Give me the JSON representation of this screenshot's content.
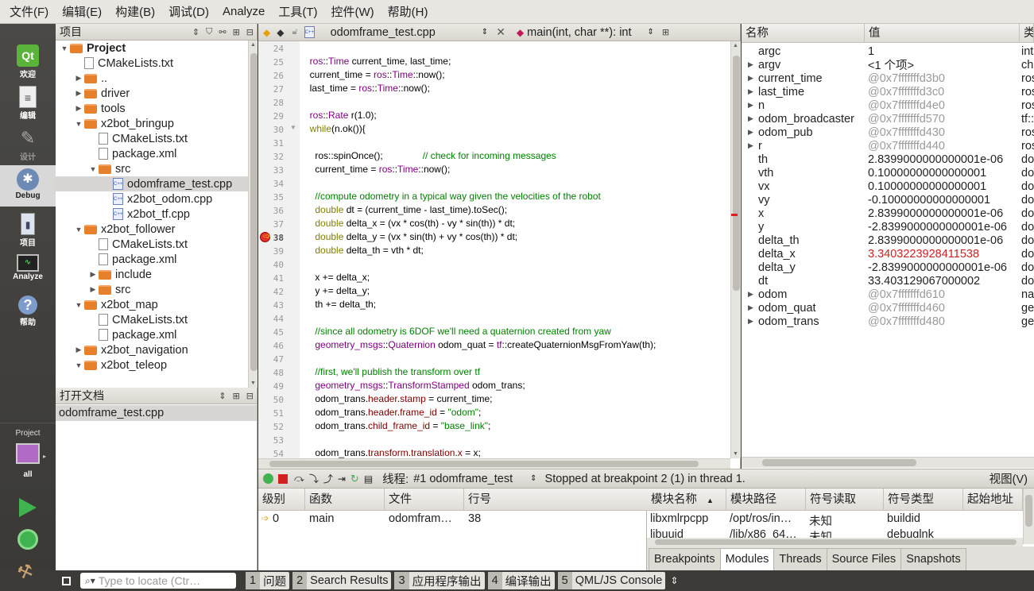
{
  "menu": [
    "文件(F)",
    "编辑(E)",
    "构建(B)",
    "调试(D)",
    "Analyze",
    "工具(T)",
    "控件(W)",
    "帮助(H)"
  ],
  "modes": [
    {
      "label": "欢迎",
      "icon": "qt-logo-icon"
    },
    {
      "label": "编辑",
      "icon": "edit-document-icon"
    },
    {
      "label": "设计",
      "icon": "design-tools-icon"
    },
    {
      "label": "Debug",
      "icon": "debug-bug-icon"
    },
    {
      "label": "项目",
      "icon": "project-wrench-icon"
    },
    {
      "label": "Analyze",
      "icon": "analyze-monitor-icon"
    },
    {
      "label": "帮助",
      "icon": "help-icon"
    }
  ],
  "kit": {
    "project_label": "Project",
    "config_label": "all"
  },
  "project_pane": {
    "title": "项目",
    "tree": [
      {
        "label": "Project",
        "indent": 0,
        "kind": "folder",
        "expanded": true,
        "bold": true
      },
      {
        "label": "CMakeLists.txt",
        "indent": 1,
        "kind": "file"
      },
      {
        "label": "..",
        "indent": 1,
        "kind": "folder",
        "expanded": false
      },
      {
        "label": "driver",
        "indent": 1,
        "kind": "folder",
        "expanded": false
      },
      {
        "label": "tools",
        "indent": 1,
        "kind": "folder",
        "expanded": false
      },
      {
        "label": "x2bot_bringup",
        "indent": 1,
        "kind": "folder",
        "expanded": true
      },
      {
        "label": "CMakeLists.txt",
        "indent": 2,
        "kind": "file"
      },
      {
        "label": "package.xml",
        "indent": 2,
        "kind": "file"
      },
      {
        "label": "src",
        "indent": 2,
        "kind": "folder",
        "expanded": true
      },
      {
        "label": "odomframe_test.cpp",
        "indent": 3,
        "kind": "cpp",
        "selected": true
      },
      {
        "label": "x2bot_odom.cpp",
        "indent": 3,
        "kind": "cpp"
      },
      {
        "label": "x2bot_tf.cpp",
        "indent": 3,
        "kind": "cpp"
      },
      {
        "label": "x2bot_follower",
        "indent": 1,
        "kind": "folder",
        "expanded": true
      },
      {
        "label": "CMakeLists.txt",
        "indent": 2,
        "kind": "file"
      },
      {
        "label": "package.xml",
        "indent": 2,
        "kind": "file"
      },
      {
        "label": "include",
        "indent": 2,
        "kind": "folder",
        "expanded": false
      },
      {
        "label": "src",
        "indent": 2,
        "kind": "folder",
        "expanded": false
      },
      {
        "label": "x2bot_map",
        "indent": 1,
        "kind": "folder",
        "expanded": true
      },
      {
        "label": "CMakeLists.txt",
        "indent": 2,
        "kind": "file"
      },
      {
        "label": "package.xml",
        "indent": 2,
        "kind": "file"
      },
      {
        "label": "x2bot_navigation",
        "indent": 1,
        "kind": "folder",
        "expanded": false
      },
      {
        "label": "x2bot_teleop",
        "indent": 1,
        "kind": "folder",
        "expanded": true
      }
    ]
  },
  "open_docs": {
    "title": "打开文档",
    "items": [
      "odomframe_test.cpp"
    ]
  },
  "editor": {
    "file": "odomframe_test.cpp",
    "function": "main(int, char **): int",
    "breakpoint_line": "38",
    "lines": [
      {
        "n": "24",
        "html": ""
      },
      {
        "n": "25",
        "html": "  <span class=\"ty\">ros</span>::<span class=\"ty\">Time</span> current_time, last_time;"
      },
      {
        "n": "26",
        "html": "  current_time = <span class=\"ty\">ros</span>::<span class=\"ty\">Time</span>::now();"
      },
      {
        "n": "27",
        "html": "  last_time = <span class=\"ty\">ros</span>::<span class=\"ty\">Time</span>::now();"
      },
      {
        "n": "28",
        "html": ""
      },
      {
        "n": "29",
        "html": "  <span class=\"ty\">ros</span>::<span class=\"ty\">Rate</span> r(1.0);"
      },
      {
        "n": "30",
        "html": "  <span class=\"kw\">while</span>(n.ok()){"
      },
      {
        "n": "31",
        "html": ""
      },
      {
        "n": "32",
        "html": "    ros::spinOnce();               <span class=\"cm\">// check for incoming messages</span>"
      },
      {
        "n": "33",
        "html": "    current_time = <span class=\"ty\">ros</span>::<span class=\"ty\">Time</span>::now();"
      },
      {
        "n": "34",
        "html": ""
      },
      {
        "n": "35",
        "html": "    <span class=\"cm\">//compute odometry in a typical way given the velocities of the robot</span>"
      },
      {
        "n": "36",
        "html": "    <span class=\"kw\">double</span> dt = (current_time - last_time).toSec();"
      },
      {
        "n": "37",
        "html": "    <span class=\"kw\">double</span> delta_x = (vx * cos(th) - vy * sin(th)) * dt;"
      },
      {
        "n": "38",
        "html": "    <span class=\"kw\">double</span> delta_y = (vx * sin(th) + vy * cos(th)) * dt;"
      },
      {
        "n": "39",
        "html": "    <span class=\"kw\">double</span> delta_th = vth * dt;"
      },
      {
        "n": "40",
        "html": ""
      },
      {
        "n": "41",
        "html": "    x += delta_x;"
      },
      {
        "n": "42",
        "html": "    y += delta_y;"
      },
      {
        "n": "43",
        "html": "    th += delta_th;"
      },
      {
        "n": "44",
        "html": ""
      },
      {
        "n": "45",
        "html": "    <span class=\"cm\">//since all odometry is 6DOF we'll need a quaternion created from yaw</span>"
      },
      {
        "n": "46",
        "html": "    <span class=\"ty\">geometry_msgs</span>::<span class=\"ty\">Quaternion</span> odom_quat = <span class=\"ty\">tf</span>::createQuaternionMsgFromYaw(th);"
      },
      {
        "n": "47",
        "html": ""
      },
      {
        "n": "48",
        "html": "    <span class=\"cm\">//first, we'll publish the transform over tf</span>"
      },
      {
        "n": "49",
        "html": "    <span class=\"ty\">geometry_msgs</span>::<span class=\"ty\">TransformStamped</span> odom_trans;"
      },
      {
        "n": "50",
        "html": "    odom_trans.<span class=\"mb\">header</span>.<span class=\"mb\">stamp</span> = current_time;"
      },
      {
        "n": "51",
        "html": "    odom_trans.<span class=\"mb\">header</span>.<span class=\"mb\">frame_id</span> = <span class=\"st\">\"odom\"</span>;"
      },
      {
        "n": "52",
        "html": "    odom_trans.<span class=\"mb\">child_frame_id</span> = <span class=\"st\">\"base_link\"</span>;"
      },
      {
        "n": "53",
        "html": ""
      },
      {
        "n": "54",
        "html": "    odom_trans.<span class=\"mb\">transform</span>.<span class=\"mb\">translation</span>.<span class=\"mb\">x</span> = x;"
      }
    ]
  },
  "locals": {
    "headers": [
      "名称",
      "值",
      "类"
    ],
    "rows": [
      {
        "name": "argc",
        "value": "1",
        "type": "int",
        "expandable": false,
        "dim": false
      },
      {
        "name": "argv",
        "value": "<1 个项>",
        "type": "cha",
        "expandable": true,
        "dim": false
      },
      {
        "name": "current_time",
        "value": "@0x7fffffffd3b0",
        "type": "ros",
        "expandable": true,
        "dim": true
      },
      {
        "name": "last_time",
        "value": "@0x7fffffffd3c0",
        "type": "ros",
        "expandable": true,
        "dim": true
      },
      {
        "name": "n",
        "value": "@0x7fffffffd4e0",
        "type": "ros",
        "expandable": true,
        "dim": true
      },
      {
        "name": "odom_broadcaster",
        "value": "@0x7fffffffd570",
        "type": "tf::",
        "expandable": true,
        "dim": true
      },
      {
        "name": "odom_pub",
        "value": "@0x7fffffffd430",
        "type": "ros",
        "expandable": true,
        "dim": true
      },
      {
        "name": "r",
        "value": "@0x7fffffffd440",
        "type": "ros",
        "expandable": true,
        "dim": true
      },
      {
        "name": "th",
        "value": "2.8399000000000001e-06",
        "type": "do",
        "expandable": false,
        "dim": false
      },
      {
        "name": "vth",
        "value": "0.10000000000000001",
        "type": "do",
        "expandable": false,
        "dim": false
      },
      {
        "name": "vx",
        "value": "0.10000000000000001",
        "type": "do",
        "expandable": false,
        "dim": false
      },
      {
        "name": "vy",
        "value": "-0.10000000000000001",
        "type": "do",
        "expandable": false,
        "dim": false
      },
      {
        "name": "x",
        "value": "2.8399000000000001e-06",
        "type": "do",
        "expandable": false,
        "dim": false
      },
      {
        "name": "y",
        "value": "-2.8399000000000001e-06",
        "type": "do",
        "expandable": false,
        "dim": false
      },
      {
        "name": "delta_th",
        "value": "2.8399000000000001e-06",
        "type": "do",
        "expandable": false,
        "dim": false
      },
      {
        "name": "delta_x",
        "value": "3.3403223928411538",
        "type": "do",
        "expandable": false,
        "dim": false,
        "changed": true
      },
      {
        "name": "delta_y",
        "value": "-2.8399000000000001e-06",
        "type": "do",
        "expandable": false,
        "dim": false
      },
      {
        "name": "dt",
        "value": "33.403129067000002",
        "type": "do",
        "expandable": false,
        "dim": false
      },
      {
        "name": "odom",
        "value": "@0x7fffffffd610",
        "type": "nav",
        "expandable": true,
        "dim": true
      },
      {
        "name": "odom_quat",
        "value": "@0x7fffffffd460",
        "type": "ge",
        "expandable": true,
        "dim": true
      },
      {
        "name": "odom_trans",
        "value": "@0x7fffffffd480",
        "type": "ge",
        "expandable": true,
        "dim": true
      }
    ]
  },
  "debug_toolbar": {
    "thread_label": "线程:",
    "thread_value": "#1 odomframe_test",
    "status": "Stopped at breakpoint 2 (1) in thread 1.",
    "view_menu": "视图(V)"
  },
  "stack": {
    "headers": [
      "级别",
      "函数",
      "文件",
      "行号"
    ],
    "rows": [
      {
        "level": "0",
        "function": "main",
        "file": "odomfram…",
        "line": "38"
      }
    ]
  },
  "modules": {
    "headers": [
      "模块名称",
      "模块路径",
      "符号读取",
      "符号类型",
      "起始地址"
    ],
    "rows": [
      {
        "name": "libxmlrpcpp",
        "path": "/opt/ros/in…",
        "read": "未知",
        "type": "buildid",
        "start": ""
      },
      {
        "name": "libuuid",
        "path": "/lib/x86_64…",
        "read": "未知",
        "type": "debuglnk",
        "start": ""
      }
    ]
  },
  "bottom_tabs": [
    "Breakpoints",
    "Modules",
    "Threads",
    "Source Files",
    "Snapshots"
  ],
  "bottom_tabs_selected": "Modules",
  "status_bar": {
    "locate_placeholder": "Type to locate (Ctr…",
    "panes": [
      {
        "num": "1",
        "label": "问题"
      },
      {
        "num": "2",
        "label": "Search Results"
      },
      {
        "num": "3",
        "label": "应用程序输出"
      },
      {
        "num": "4",
        "label": "编译输出"
      },
      {
        "num": "5",
        "label": "QML/JS Console"
      }
    ]
  }
}
